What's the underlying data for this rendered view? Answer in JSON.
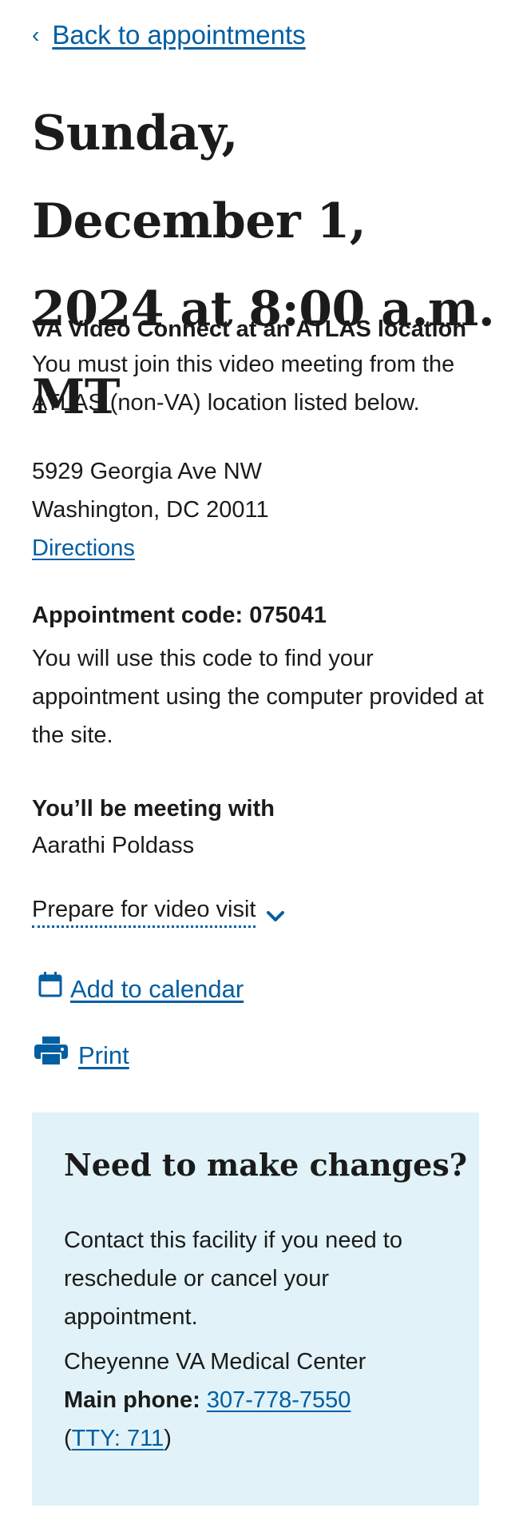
{
  "nav": {
    "back_label": "Back to appointments"
  },
  "appointment": {
    "date_heading": "Sunday, December 1, 2024 at 8:00 a.m. MT",
    "type_title": "VA Video Connect at an ATLAS location",
    "type_description": "You must join this video meeting from the ATLAS (non-VA) location listed below.",
    "address_line1": "5929 Georgia Ave NW",
    "address_line2": "Washington, DC 20011",
    "directions_label": "Directions",
    "code_label": "Appointment code: 075041",
    "code_description": "You will use this code to find your appointment using the computer provided at the site.",
    "meeting_with_label": "You’ll be meeting with",
    "provider_name": "Aarathi Poldass",
    "prepare_label": "Prepare for video visit",
    "calendar_label": "Add to calendar",
    "print_label": "Print"
  },
  "changes": {
    "title": "Need to make changes?",
    "description": "Contact this facility if you need to reschedule or cancel your appointment.",
    "facility_name": "Cheyenne VA Medical Center",
    "phone_label": "Main phone:",
    "phone_number": "307-778-7550",
    "tty_open": "(",
    "tty_label": "TTY: 711",
    "tty_close": ")"
  },
  "colors": {
    "link": "#005ea2",
    "text": "#1b1b1b",
    "info_box_bg": "#e1f3f8"
  },
  "icons": {
    "back": "chevron-left-icon",
    "prepare": "chevron-down-icon",
    "calendar": "calendar-icon",
    "print": "printer-icon"
  }
}
